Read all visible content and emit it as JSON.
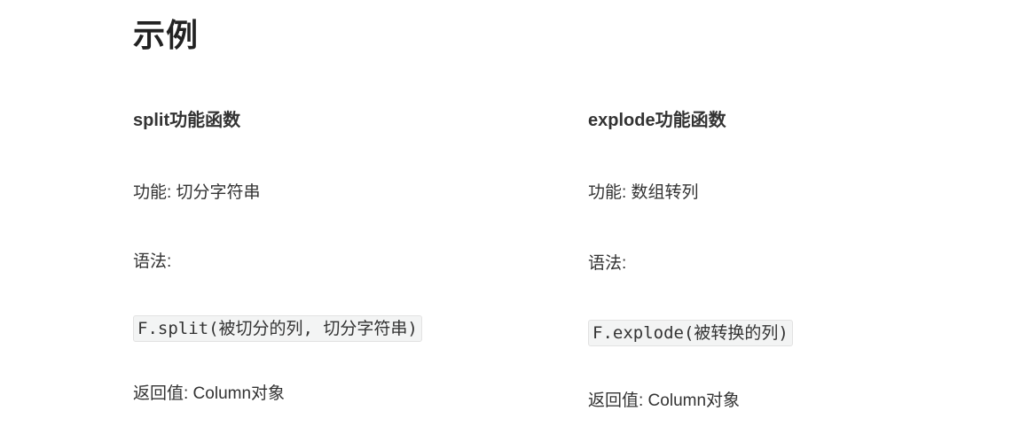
{
  "page": {
    "title": "示例"
  },
  "split": {
    "heading": "split功能函数",
    "purpose": "功能: 切分字符串",
    "syntax_label": "语法:",
    "code": "F.split(被切分的列, 切分字符串)",
    "returns": "返回值: Column对象"
  },
  "explode": {
    "heading": "explode功能函数",
    "purpose": "功能: 数组转列",
    "syntax_label": "语法:",
    "code": "F.explode(被转换的列)",
    "returns": "返回值: Column对象"
  }
}
